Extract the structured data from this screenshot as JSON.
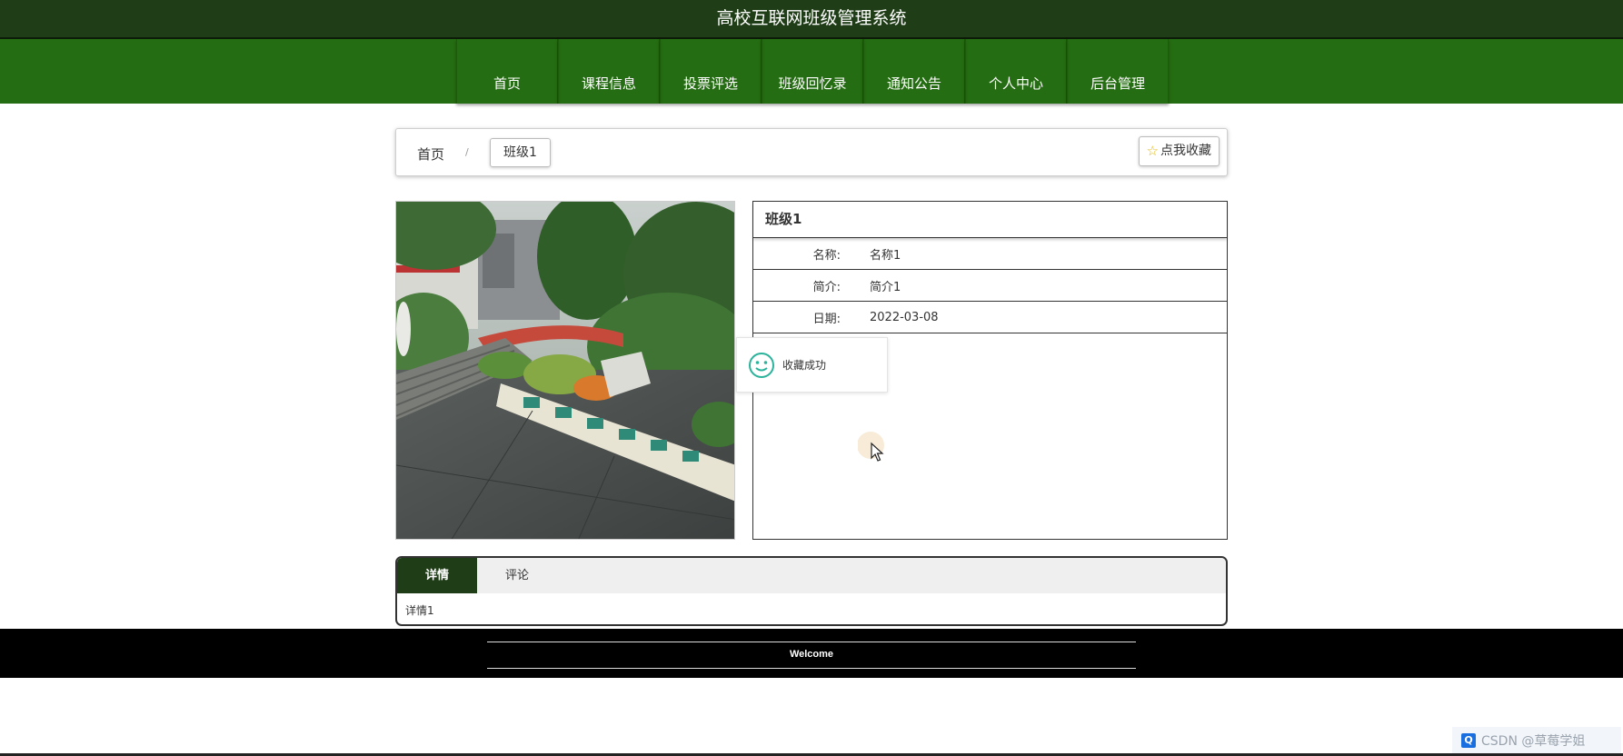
{
  "header": {
    "site_title": "高校互联网班级管理系统"
  },
  "nav": {
    "items": [
      {
        "label": "首页"
      },
      {
        "label": "课程信息"
      },
      {
        "label": "投票评选"
      },
      {
        "label": "班级回忆录"
      },
      {
        "label": "通知公告"
      },
      {
        "label": "个人中心"
      },
      {
        "label": "后台管理"
      }
    ]
  },
  "breadcrumb": {
    "home": "首页",
    "separator": "/",
    "current": "班级1"
  },
  "favorite": {
    "label": "点我收藏",
    "icon": "star-icon"
  },
  "detail": {
    "title": "班级1",
    "rows": [
      {
        "label": "名称:",
        "value": "名称1"
      },
      {
        "label": "简介:",
        "value": "简介1"
      },
      {
        "label": "日期:",
        "value": "2022-03-08"
      }
    ]
  },
  "toast": {
    "message": "收藏成功",
    "icon": "smile-icon"
  },
  "tabs": {
    "items": [
      {
        "label": "详情"
      },
      {
        "label": "评论"
      }
    ],
    "active": "详情",
    "content": "详情1"
  },
  "footer": {
    "text": "Welcome"
  },
  "watermark": {
    "text": "CSDN @草莓学姐"
  },
  "colors": {
    "header": "#1f3d16",
    "nav": "#256d12",
    "tab_active": "#1f3d16",
    "footer": "#000000"
  }
}
